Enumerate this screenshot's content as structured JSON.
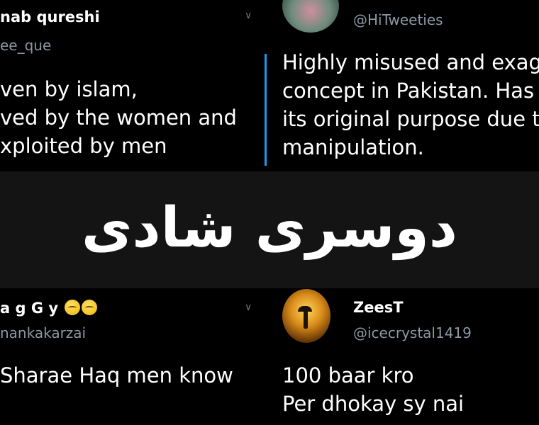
{
  "tweets": [
    {
      "name": "nab qureshi",
      "handle": "ee_que",
      "lines": [
        "ven by islam,",
        "ved by the women and",
        "xploited by men"
      ]
    },
    {
      "handle": "@HiTweeties",
      "lines": [
        "Highly misused and exag",
        "concept in Pakistan. Has",
        "its original purpose due to",
        "manipulation."
      ]
    },
    {
      "name": "a g G y",
      "handle": "nankakarzai",
      "lines": [
        "Sharae Haq men know"
      ]
    },
    {
      "name": "ZeesT",
      "handle": "@icecrystal1419",
      "lines": [
        "100 baar kro",
        "Per dhokay sy nai"
      ]
    }
  ],
  "banner": {
    "text": "دوسری شادی"
  },
  "icons": {
    "more": "chevron-down-icon",
    "emoji": "sleeping-face-icon"
  },
  "colors": {
    "background": "#000000",
    "banner": "#141414",
    "handle": "#8b98a5",
    "thread": "#1d9bf0"
  }
}
